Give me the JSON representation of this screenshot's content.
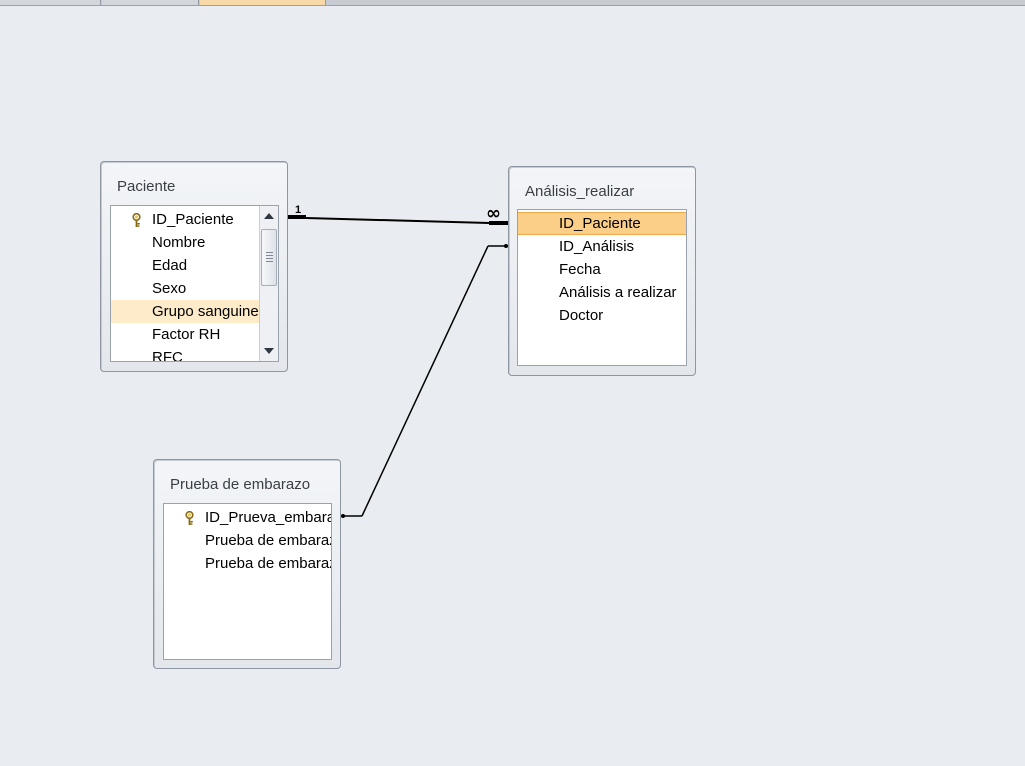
{
  "tables": {
    "paciente": {
      "title": "Paciente",
      "fields": [
        "ID_Paciente",
        "Nombre",
        "Edad",
        "Sexo",
        "Grupo sanguineo",
        "Factor RH",
        "RFC"
      ]
    },
    "analisis": {
      "title": "Análisis_realizar",
      "fields": [
        "ID_Paciente",
        "ID_Análisis",
        "Fecha",
        "Análisis a realizar",
        "Doctor"
      ]
    },
    "prueba": {
      "title": "Prueba de embarazo",
      "fields": [
        "ID_Prueva_embarazo",
        "Prueba de embarazo",
        "Prueba de embarazo"
      ]
    }
  },
  "relationships": {
    "paciente_analisis": {
      "one_label": "1",
      "many_label": "∞"
    }
  },
  "icons": {
    "primary_key": "key-icon",
    "scroll_up": "scroll-up-arrow-icon",
    "scroll_down": "scroll-down-arrow-icon"
  },
  "colors": {
    "canvas": "#e9edf1",
    "selected_field": "#fbcf87",
    "hover_field": "#fdebc9"
  }
}
